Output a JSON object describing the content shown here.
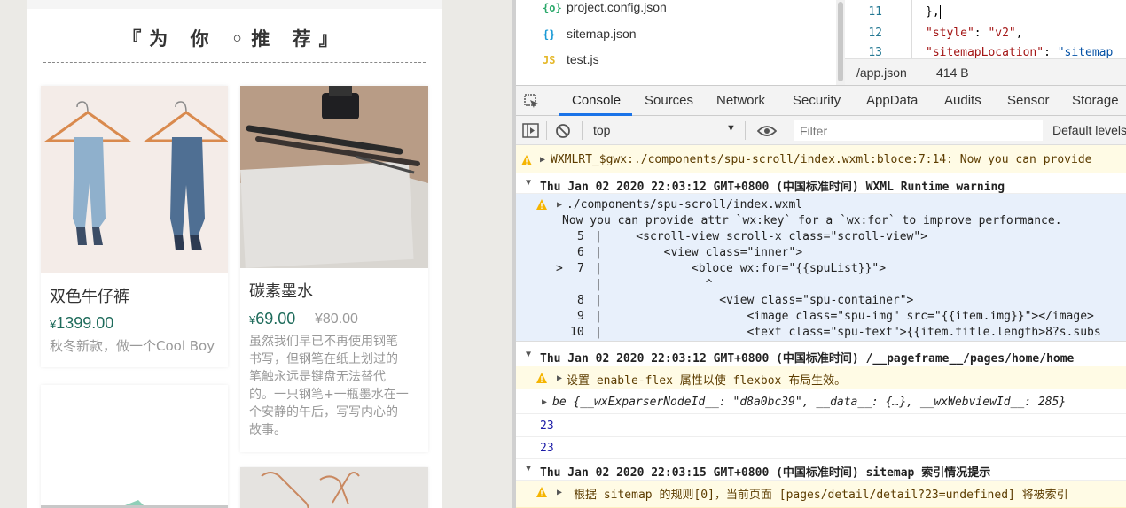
{
  "simulator": {
    "section_title": "『为 你 ◦推 荐』",
    "products": [
      {
        "title": "双色牛仔裤",
        "currency": "¥",
        "price": "1399.00",
        "desc": "秋冬新款，做一个Cool Boy"
      },
      {
        "title": "碳素墨水",
        "currency": "¥",
        "price": "69.00",
        "orig_price": "¥80.00",
        "desc_lines": [
          "虽然我们早已不再使用钢笔",
          "书写，但钢笔在纸上划过的",
          "笔触永远是键盘无法替代",
          "的。一只钢笔+一瓶墨水在一",
          "个安静的午后，写写内心的",
          "故事。"
        ]
      }
    ]
  },
  "file_tree": {
    "items": [
      {
        "icon": "{o}",
        "name": "project.config.json"
      },
      {
        "icon": "{}",
        "name": "sitemap.json"
      },
      {
        "icon": "JS",
        "name": "test.js"
      }
    ]
  },
  "editor": {
    "lines": [
      {
        "num": "11",
        "text": "},"
      },
      {
        "num": "12",
        "key": "\"style\"",
        "sep": ": ",
        "val": "\"v2\"",
        "end": ","
      },
      {
        "num": "13",
        "key": "\"sitemapLocation\"",
        "sep": ": ",
        "val": "\"sitemap",
        "end": ""
      }
    ],
    "path": "/app.json",
    "size": "414 B"
  },
  "devtools": {
    "tabs": [
      "Console",
      "Sources",
      "Network",
      "Security",
      "AppData",
      "Audits",
      "Sensor",
      "Storage"
    ],
    "active_tab": "Console",
    "context": "top",
    "filter_placeholder": "Filter",
    "levels": "Default levels"
  },
  "console": {
    "warn1": "WXMLRT_$gwx:./components/spu-scroll/index.wxml:bloce:7:14: Now you can provide",
    "group1": "Thu Jan 02 2020 22:03:12 GMT+0800 (中国标准时间) WXML Runtime warning",
    "frame_file": "./components/spu-scroll/index.wxml",
    "frame_msg": "Now you can provide attr `wx:key` for a `wx:for` to improve performance.",
    "frame_lines": [
      {
        "marker": "",
        "num": "5",
        "code": "    <scroll-view scroll-x class=\"scroll-view\">"
      },
      {
        "marker": "",
        "num": "6",
        "code": "        <view class=\"inner\">"
      },
      {
        "marker": ">",
        "num": "7",
        "code": "            <bloce wx:for=\"{{spuList}}\">"
      },
      {
        "marker": "",
        "num": "",
        "code": "              ^"
      },
      {
        "marker": "",
        "num": "8",
        "code": "                <view class=\"spu-container\">"
      },
      {
        "marker": "",
        "num": "9",
        "code": "                    <image class=\"spu-img\" src=\"{{item.img}}\"></image>"
      },
      {
        "marker": "",
        "num": "10",
        "code": "                    <text class=\"spu-text\">{{item.title.length>8?s.subs"
      }
    ],
    "group2": "Thu Jan 02 2020 22:03:12 GMT+0800 (中国标准时间) /__pageframe__/pages/home/home",
    "warn2": "设置 enable-flex 属性以使 flexbox 布局生效。",
    "log_be": "be {__wxExparserNodeId__: \"d8a0bc39\", __data__: {…}, __wxWebviewId__: 285}",
    "num1": "23",
    "num2": "23",
    "group3": "Thu Jan 02 2020 22:03:15 GMT+0800 (中国标准时间) sitemap 索引情况提示",
    "warn3": "根据 sitemap 的规则[0]，当前页面 [pages/detail/detail?23=undefined] 将被索引"
  },
  "colors": {
    "accent": "#1a73e8",
    "price": "#1e6b5b",
    "warn_bg": "#fffbe5",
    "frame_bg": "#e8f0fb"
  }
}
